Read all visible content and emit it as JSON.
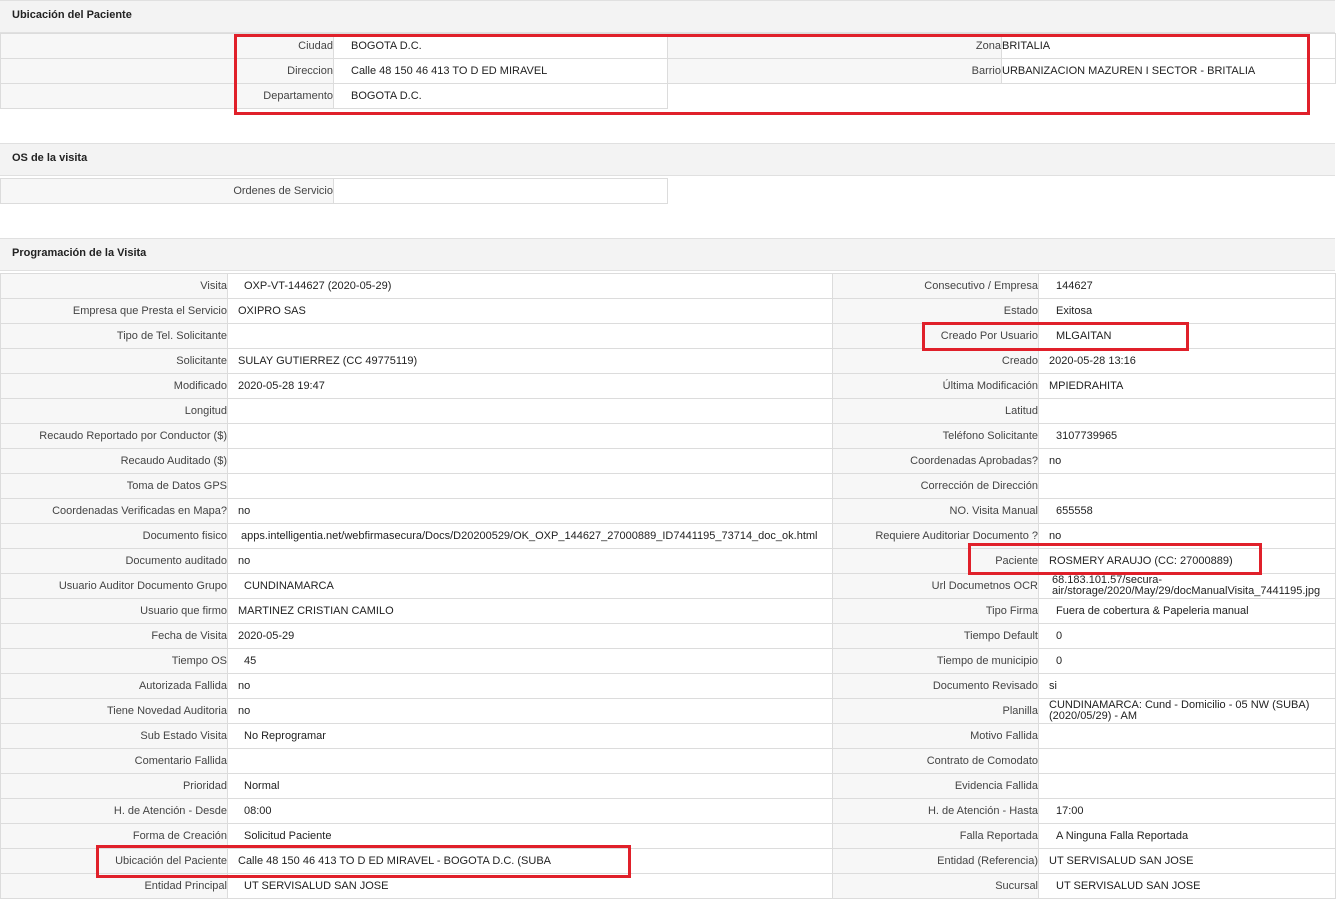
{
  "sections": {
    "ubicacion": "Ubicación del Paciente",
    "os": "OS de la visita",
    "programacion": "Programación de la Visita"
  },
  "ubicacion": {
    "ciudad_label": "Ciudad",
    "ciudad": "BOGOTA D.C.",
    "zona_label": "Zona",
    "zona": "BRITALIA",
    "direccion_label": "Direccion",
    "direccion": "Calle 48 150 46 413 TO D ED MIRAVEL",
    "barrio_label": "Barrio",
    "barrio": "URBANIZACION MAZUREN I SECTOR - BRITALIA",
    "departamento_label": "Departamento",
    "departamento": "BOGOTA D.C."
  },
  "os": {
    "ordenes_label": "Ordenes de Servicio",
    "ordenes": ""
  },
  "rows": [
    {
      "l1": "Visita",
      "v1": "OXP-VT-144627 (2020-05-29)",
      "l2": "Consecutivo / Empresa",
      "v2": "144627"
    },
    {
      "l1": "Empresa que Presta el Servicio",
      "v1": "OXIPRO SAS",
      "l2": "Estado",
      "v2": "Exitosa"
    },
    {
      "l1": "Tipo de Tel. Solicitante",
      "v1": "",
      "l2": "Creado Por Usuario",
      "v2": "MLGAITAN"
    },
    {
      "l1": "Solicitante",
      "v1": "SULAY GUTIERREZ (CC 49775119)",
      "l2": "Creado",
      "v2": "2020-05-28 13:16"
    },
    {
      "l1": "Modificado",
      "v1": "2020-05-28 19:47",
      "l2": "Última Modificación",
      "v2": "MPIEDRAHITA"
    },
    {
      "l1": "Longitud",
      "v1": "",
      "l2": "Latitud",
      "v2": ""
    },
    {
      "l1": "Recaudo Reportado por Conductor ($)",
      "v1": "",
      "l2": "Teléfono Solicitante",
      "v2": "3107739965"
    },
    {
      "l1": "Recaudo Auditado ($)",
      "v1": "",
      "l2": "Coordenadas Aprobadas?",
      "v2": "no"
    },
    {
      "l1": "Toma de Datos GPS",
      "v1": "",
      "l2": "Corrección de Dirección",
      "v2": ""
    },
    {
      "l1": "Coordenadas Verificadas en Mapa?",
      "v1": "no",
      "l2": "NO. Visita Manual",
      "v2": "655558"
    },
    {
      "l1": "Documento fisico",
      "v1": "apps.intelligentia.net/webfirmasecura/Docs/D20200529/OK_OXP_144627_27000889_ID7441195_73714_doc_ok.html",
      "l2": "Requiere Auditoriar Documento ?",
      "v2": "no"
    },
    {
      "l1": "Documento auditado",
      "v1": "no",
      "l2": "Paciente",
      "v2": "ROSMERY ARAUJO (CC: 27000889)"
    },
    {
      "l1": "Usuario Auditor Documento Grupo",
      "v1": "CUNDINAMARCA",
      "l2": "Url Documetnos OCR",
      "v2": "68.183.101.57/secura-air/storage/2020/May/29/docManualVisita_7441195.jpg"
    },
    {
      "l1": "Usuario que firmo",
      "v1": "MARTINEZ CRISTIAN CAMILO",
      "l2": "Tipo Firma",
      "v2": "Fuera de cobertura & Papeleria manual"
    },
    {
      "l1": "Fecha de Visita",
      "v1": "2020-05-29",
      "l2": "Tiempo Default",
      "v2": "0"
    },
    {
      "l1": "Tiempo OS",
      "v1": "45",
      "l2": "Tiempo de municipio",
      "v2": "0"
    },
    {
      "l1": "Autorizada Fallida",
      "v1": "no",
      "l2": "Documento Revisado",
      "v2": "si"
    },
    {
      "l1": "Tiene Novedad Auditoria",
      "v1": "no",
      "l2": "Planilla",
      "v2": "CUNDINAMARCA: Cund - Domicilio - 05 NW (SUBA) (2020/05/29) - AM"
    },
    {
      "l1": "Sub Estado Visita",
      "v1": "No Reprogramar",
      "l2": "Motivo Fallida",
      "v2": ""
    },
    {
      "l1": "Comentario Fallida",
      "v1": "",
      "l2": "Contrato de Comodato",
      "v2": ""
    },
    {
      "l1": "Prioridad",
      "v1": "Normal",
      "l2": "Evidencia Fallida",
      "v2": ""
    },
    {
      "l1": "H. de Atención - Desde",
      "v1": "08:00",
      "l2": "H. de Atención - Hasta",
      "v2": "17:00"
    },
    {
      "l1": "Forma de Creación",
      "v1": "Solicitud Paciente",
      "l2": "Falla Reportada",
      "v2": "A Ninguna Falla Reportada"
    },
    {
      "l1": "Ubicación del Paciente",
      "v1": "Calle 48 150 46 413 TO D ED MIRAVEL - BOGOTA D.C. (SUBA",
      "l2": "Entidad (Referencia)",
      "v2": "UT SERVISALUD SAN JOSE"
    },
    {
      "l1": "Entidad Principal",
      "v1": "UT SERVISALUD SAN JOSE",
      "l2": "Sucursal",
      "v2": "UT SERVISALUD SAN JOSE"
    }
  ]
}
